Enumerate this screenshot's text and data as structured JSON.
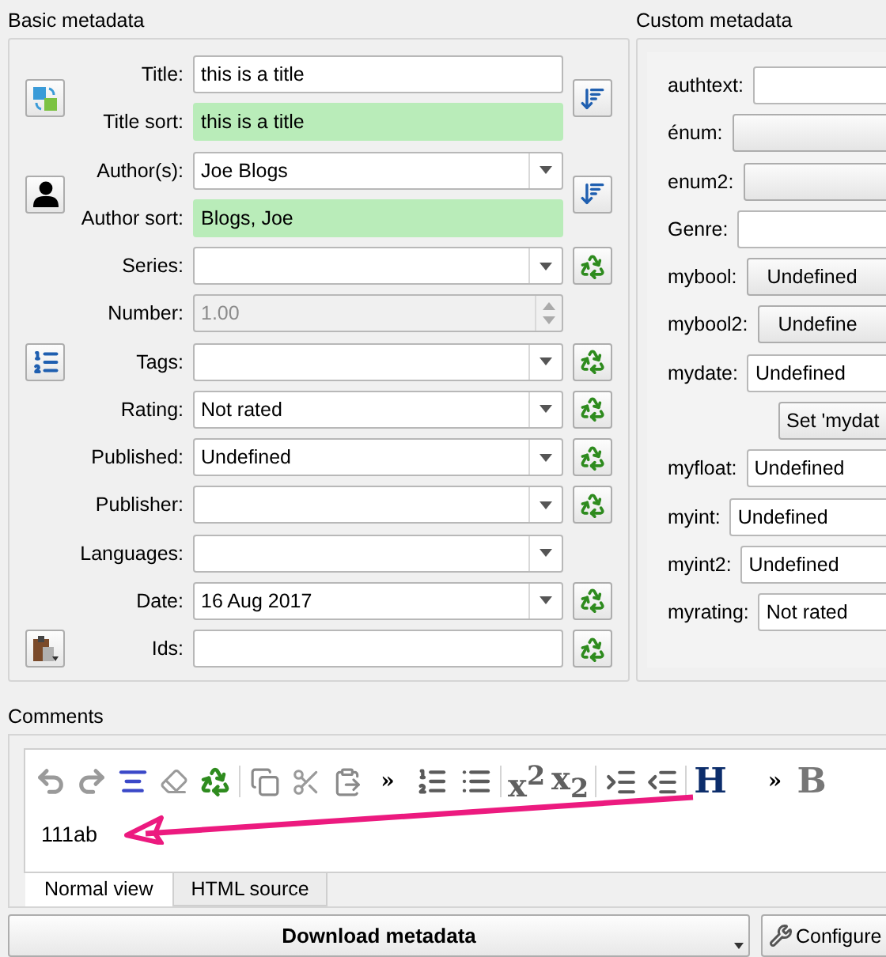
{
  "basic_metadata": {
    "title": "Basic metadata",
    "rows": [
      {
        "label": "Title:",
        "kind": "text",
        "value": "this is a title",
        "highlighted": false,
        "disabled": false,
        "reset": false
      },
      {
        "label": "Title sort:",
        "kind": "text",
        "value": "this is a title",
        "highlighted": true,
        "disabled": false,
        "reset": false
      },
      {
        "label": "Author(s):",
        "kind": "combo",
        "value": "Joe Blogs",
        "highlighted": false,
        "disabled": false,
        "reset": false
      },
      {
        "label": "Author sort:",
        "kind": "text",
        "value": "Blogs, Joe",
        "highlighted": true,
        "disabled": false,
        "reset": false
      },
      {
        "label": "Series:",
        "kind": "combo",
        "highlighted": false,
        "disabled": false,
        "reset": true
      },
      {
        "label": "Number:",
        "kind": "spin",
        "value": "1.00",
        "highlighted": false,
        "disabled": true,
        "reset": false
      },
      {
        "label": "Tags:",
        "kind": "combo",
        "highlighted": false,
        "disabled": false,
        "reset": true
      },
      {
        "label": "Rating:",
        "kind": "combo",
        "value": "Not rated",
        "highlighted": false,
        "disabled": false,
        "reset": true
      },
      {
        "label": "Published:",
        "kind": "combo",
        "value": "Undefined",
        "highlighted": false,
        "disabled": false,
        "reset": true
      },
      {
        "label": "Publisher:",
        "kind": "combo",
        "highlighted": false,
        "disabled": false,
        "reset": true
      },
      {
        "label": "Languages:",
        "kind": "combo",
        "highlighted": false,
        "disabled": false,
        "reset": false
      },
      {
        "label": "Date:",
        "kind": "combo",
        "value": "16 Aug 2017",
        "highlighted": false,
        "disabled": false,
        "reset": true
      },
      {
        "label": "Ids:",
        "kind": "text",
        "highlighted": false,
        "disabled": false,
        "reset": true
      }
    ]
  },
  "custom_metadata": {
    "title": "Custom metadata",
    "rows": [
      {
        "label": "authtext:",
        "kind": "field"
      },
      {
        "label": "énum:",
        "kind": "button"
      },
      {
        "label": "enum2:",
        "kind": "button"
      },
      {
        "label": "Genre:",
        "kind": "field"
      },
      {
        "label": "mybool:",
        "kind": "button",
        "value": "Undefined"
      },
      {
        "label": "mybool2:",
        "kind": "button",
        "value": "Undefine"
      },
      {
        "label": "mydate:",
        "kind": "field",
        "value": "Undefined"
      },
      {
        "kind": "button",
        "value": "Set 'mydat"
      },
      {
        "label": "myfloat:",
        "kind": "field",
        "value": "Undefined"
      },
      {
        "label": "myint:",
        "kind": "field",
        "value": "Undefined"
      },
      {
        "label": "myint2:",
        "kind": "field",
        "value": "Undefined"
      },
      {
        "label": "myrating:",
        "kind": "field",
        "value": "Not rated"
      }
    ]
  },
  "comments": {
    "title": "Comments",
    "toolbar": [
      "»",
      "x$^{2}$",
      "x$_{2}$",
      "H",
      "»",
      "B"
    ],
    "text": "111ab",
    "tabs": [
      {
        "label": "Normal view",
        "selected": true
      },
      {
        "label": "HTML source",
        "selected": false
      }
    ]
  },
  "footer": {
    "download": "Download metadata",
    "configure": "Configure"
  }
}
